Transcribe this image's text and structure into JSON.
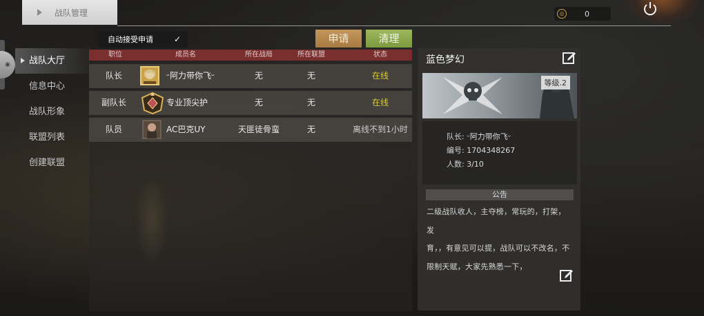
{
  "header": {
    "title": "战队管理",
    "coins": "0"
  },
  "sidebar": {
    "items": [
      {
        "label": "战队大厅"
      },
      {
        "label": "信息中心"
      },
      {
        "label": "战队形象"
      },
      {
        "label": "联盟列表"
      },
      {
        "label": "创建联盟"
      }
    ]
  },
  "toolbar": {
    "auto_accept_label": "自动接受申请",
    "auto_accept_checked": "✓",
    "apply_label": "申请",
    "clear_label": "清理"
  },
  "table": {
    "columns": [
      "职位",
      "成员名",
      "所在战局",
      "所在联盟",
      "状态"
    ],
    "rows": [
      {
        "position": "队长",
        "name": "ᵕ阿力带你飞ᵕ",
        "match": "无",
        "alliance": "无",
        "status": "在线"
      },
      {
        "position": "副队长",
        "name": "专业顶尖护",
        "match": "无",
        "alliance": "无",
        "status": "在线"
      },
      {
        "position": "队员",
        "name": "AC巴克UY",
        "match": "天匪徒骨蛮",
        "alliance": "无",
        "status": "离线不到1小时"
      }
    ]
  },
  "team": {
    "name": "蓝色梦幻",
    "level": "等级.2",
    "leader_label": "队长:",
    "leader_value": "ᵕ阿力带你飞ᵕ",
    "id_label": "编号:",
    "id_value": "1704348267",
    "count_label": "人数:",
    "count_value": "3/10",
    "notice_title": "公告",
    "notice_lines": [
      "二级战队收人，主夺榜，常玩的，打架，发",
      "育，，有意见可以提，战队可以不改名，不",
      "限制天赋，大家先熟悉一下，"
    ]
  },
  "colors": {
    "table_header": "#7a2e2e",
    "apply_button": "#b4884e",
    "clear_button": "#8aa84a",
    "online": "#d6cc3a"
  }
}
